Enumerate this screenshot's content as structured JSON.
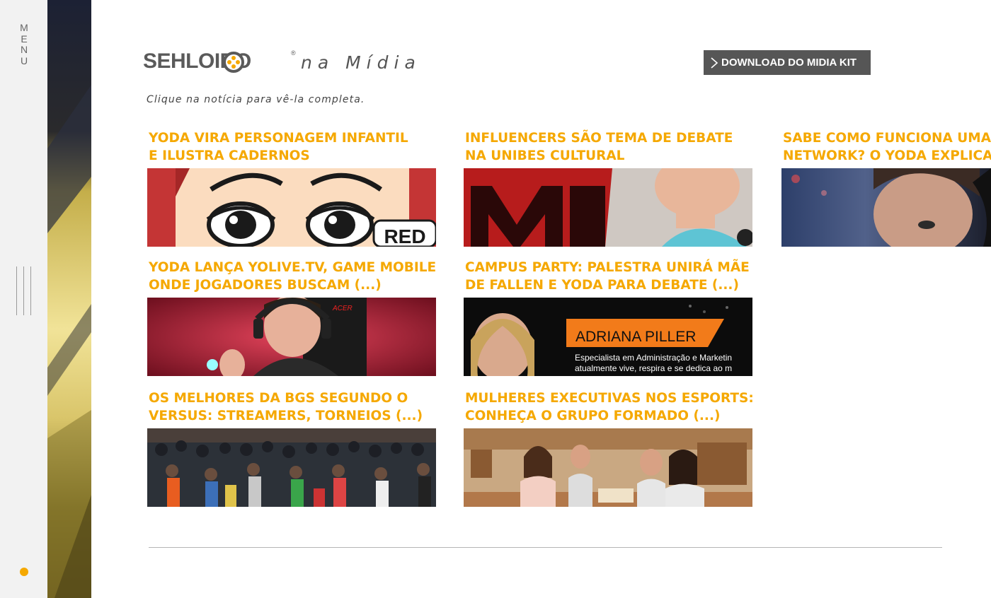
{
  "menu": {
    "label_letters": [
      "M",
      "E",
      "N",
      "U"
    ]
  },
  "header": {
    "brand": "SEHLOIRO",
    "registered_mark": "®",
    "tagline": "na Mídia",
    "download_button": "DOWNLOAD DO MIDIA KIT",
    "subtitle": "Clique na notícia para vê-la completa."
  },
  "colors": {
    "accent": "#f5a800",
    "button_bg": "#565656",
    "rail_bg": "#f2f2f2"
  },
  "news": [
    {
      "line1": "YODA VIRA PERSONAGEM INFANTIL",
      "line2": "E ILUSTRA CADERNOS",
      "thumb_text": "RED"
    },
    {
      "line1": "INFLUENCERS SÃO TEMA DE DEBATE",
      "line2": "NA UNIBES CULTURAL"
    },
    {
      "line1": "SABE COMO FUNCIONA UMA",
      "line2": "NETWORK? O YODA EXPLICA"
    },
    {
      "line1": "YODA LANÇA YOLIVE.TV, GAME MOBILE",
      "line2": "ONDE JOGADORES BUSCAM (...)",
      "thumb_text": "ACER"
    },
    {
      "line1": "CAMPUS PARTY: PALESTRA UNIRÁ MÃE",
      "line2": "DE FALLEN E YODA PARA DEBATE (...)",
      "thumb_text": "ADRIANA PILLER",
      "thumb_text_2": "Especialista em Administração e Marketin",
      "thumb_text_3": "atualmente vive, respira e se dedica ao m"
    },
    {
      "line1": "OS MELHORES DA BGS SEGUNDO O",
      "line2": "VERSUS: STREAMERS, TORNEIOS (...)"
    },
    {
      "line1": "MULHERES EXECUTIVAS NOS ESPORTS:",
      "line2": "CONHEÇA O GRUPO FORMADO (...)"
    }
  ]
}
